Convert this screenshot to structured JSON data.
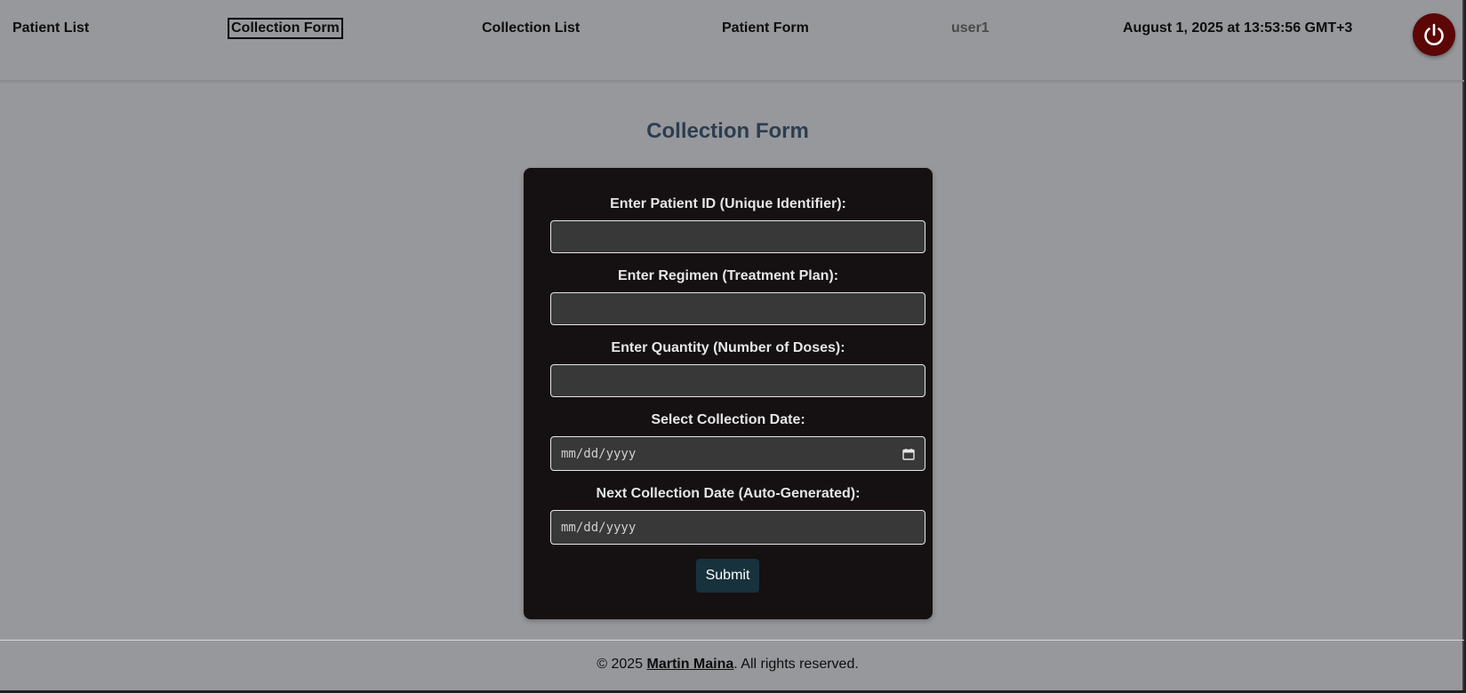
{
  "nav": {
    "patient_list": "Patient List",
    "collection_form": "Collection Form",
    "collection_list": "Collection List",
    "patient_form": "Patient Form",
    "user": "user1",
    "datetime": "August 1, 2025 at 13:53:56 GMT+3",
    "power_icon": "power-icon",
    "active_item": "Collection Form"
  },
  "main": {
    "title": "Collection Form",
    "fields": [
      {
        "label": "Enter Patient ID (Unique Identifier):",
        "value": ""
      },
      {
        "label": "Enter Regimen (Treatment Plan):",
        "value": ""
      },
      {
        "label": "Enter Quantity (Number of Doses):",
        "value": ""
      },
      {
        "label": "Select Collection Date:",
        "placeholder": "mm/dd/yyyy"
      },
      {
        "label": "Next Collection Date (Auto-Generated):",
        "placeholder": "mm/dd/yyyy"
      }
    ],
    "submit_label": "Submit"
  },
  "footer": {
    "prefix": "© 2025 ",
    "author": "Martin Maina",
    "suffix": ". All rights reserved."
  },
  "colors": {
    "page_background": "#97989c",
    "card_background": "#151011",
    "title": "#2c3e50",
    "power_button": "#5c0606",
    "submit_button": "#17323c"
  }
}
